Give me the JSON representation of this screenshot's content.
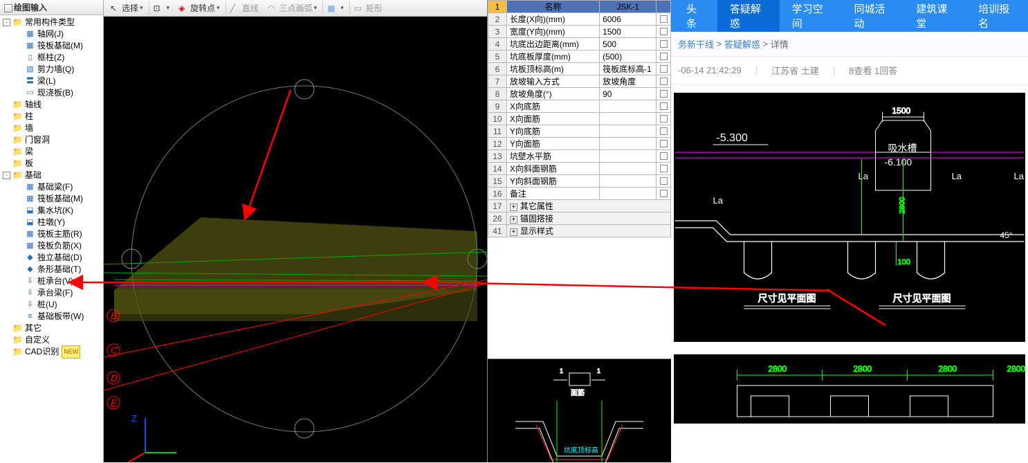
{
  "tree": {
    "title": "绘图输入",
    "nodes": [
      {
        "indent": 0,
        "toggle": "-",
        "icon": "fold",
        "label": "常用构件类型"
      },
      {
        "indent": 1,
        "icon": "blue",
        "glyph": "▦",
        "label": "轴网(J)"
      },
      {
        "indent": 1,
        "icon": "blue",
        "glyph": "▦",
        "label": "筏板基础(M)"
      },
      {
        "indent": 1,
        "icon": "blue",
        "glyph": "▯",
        "label": "框柱(Z)"
      },
      {
        "indent": 1,
        "icon": "blue",
        "glyph": "▧",
        "label": "剪力墙(Q)"
      },
      {
        "indent": 1,
        "icon": "blue",
        "glyph": "〓",
        "label": "梁(L)"
      },
      {
        "indent": 1,
        "icon": "blue",
        "glyph": "▭",
        "label": "现浇板(B)"
      },
      {
        "indent": 0,
        "icon": "fold",
        "label": "轴线"
      },
      {
        "indent": 0,
        "icon": "fold",
        "label": "柱"
      },
      {
        "indent": 0,
        "icon": "fold",
        "label": "墙"
      },
      {
        "indent": 0,
        "icon": "fold",
        "label": "门窗洞"
      },
      {
        "indent": 0,
        "icon": "fold",
        "label": "梁"
      },
      {
        "indent": 0,
        "icon": "fold",
        "label": "板"
      },
      {
        "indent": 0,
        "toggle": "-",
        "icon": "fold",
        "label": "基础"
      },
      {
        "indent": 1,
        "icon": "blue",
        "glyph": "▦",
        "label": "基础梁(F)"
      },
      {
        "indent": 1,
        "icon": "blue",
        "glyph": "▦",
        "label": "筏板基础(M)"
      },
      {
        "indent": 1,
        "icon": "blue",
        "glyph": "⬓",
        "label": "集水坑(K)"
      },
      {
        "indent": 1,
        "icon": "blue",
        "glyph": "⬓",
        "label": "柱墩(Y)"
      },
      {
        "indent": 1,
        "icon": "blue",
        "glyph": "▦",
        "label": "筏板主筋(R)"
      },
      {
        "indent": 1,
        "icon": "blue",
        "glyph": "▦",
        "label": "筏板负筋(X)"
      },
      {
        "indent": 1,
        "icon": "blue",
        "glyph": "◆",
        "label": "独立基础(D)"
      },
      {
        "indent": 1,
        "icon": "blue",
        "glyph": "◆",
        "label": "条形基础(T)"
      },
      {
        "indent": 1,
        "icon": "blue",
        "glyph": "⇩",
        "label": "桩承台(V)"
      },
      {
        "indent": 1,
        "icon": "blue",
        "glyph": "⇩",
        "label": "承台梁(F)"
      },
      {
        "indent": 1,
        "icon": "blue",
        "glyph": "⇩",
        "label": "桩(U)"
      },
      {
        "indent": 1,
        "icon": "blue",
        "glyph": "≡",
        "label": "基础板带(W)"
      },
      {
        "indent": 0,
        "icon": "fold",
        "label": "其它"
      },
      {
        "indent": 0,
        "icon": "fold",
        "label": "自定义"
      },
      {
        "indent": 0,
        "icon": "fold",
        "label": "CAD识别",
        "new": true
      }
    ]
  },
  "toolbar": {
    "select": "选择",
    "pick": "",
    "rotate": "旋转点",
    "line": "直线",
    "arc": "三点画弧",
    "rect": "矩形"
  },
  "viewport": {
    "axis_labels": [
      "B",
      "C",
      "D",
      "E"
    ],
    "zlabel": "Z"
  },
  "props": {
    "header_name": "名称",
    "header_value": "JSK-1",
    "rows": [
      {
        "n": 2,
        "name": "长度(X向)(mm)",
        "val": "6006"
      },
      {
        "n": 3,
        "name": "宽度(Y向)(mm)",
        "val": "1500"
      },
      {
        "n": 4,
        "name": "坑底出边距离(mm)",
        "val": "500"
      },
      {
        "n": 5,
        "name": "坑底板厚度(mm)",
        "val": "(500)"
      },
      {
        "n": 6,
        "name": "坑板顶标高(m)",
        "val": "筏板底标高-1"
      },
      {
        "n": 7,
        "name": "放坡输入方式",
        "val": "放坡角度"
      },
      {
        "n": 8,
        "name": "放坡角度(°)",
        "val": "90"
      },
      {
        "n": 9,
        "name": "X向底筋",
        "val": "",
        "link": true
      },
      {
        "n": 10,
        "name": "X向面筋",
        "val": "",
        "link": true
      },
      {
        "n": 11,
        "name": "Y向底筋",
        "val": "",
        "link": true
      },
      {
        "n": 12,
        "name": "Y向面筋",
        "val": "",
        "link": true
      },
      {
        "n": 13,
        "name": "坑壁水平筋",
        "val": "",
        "link": true
      },
      {
        "n": 14,
        "name": "X向斜面钢筋",
        "val": "",
        "link": true
      },
      {
        "n": 15,
        "name": "Y向斜面钢筋",
        "val": "",
        "link": true
      },
      {
        "n": 16,
        "name": "备注",
        "val": ""
      }
    ],
    "groups": [
      {
        "n": 17,
        "label": "其它属性"
      },
      {
        "n": 26,
        "label": "锚固搭接"
      },
      {
        "n": 41,
        "label": "显示样式"
      }
    ]
  },
  "web": {
    "nav": [
      {
        "label": "头条"
      },
      {
        "label": "答疑解惑",
        "active": true
      },
      {
        "label": "学习空间"
      },
      {
        "label": "同城活动"
      },
      {
        "label": "建筑课堂"
      },
      {
        "label": "培训报名"
      }
    ],
    "crumb_a": "务新干线",
    "crumb_b": "答疑解惑",
    "crumb_c": "详情",
    "meta_time": "-06-14 21:42:29",
    "meta_loc": "江苏省  土建",
    "meta_stat": "8查看  1回答",
    "dwg": {
      "elev1": "-5.300",
      "title": "吸水槽",
      "elev2": "-6.100",
      "dim_top": "1500",
      "la": "La",
      "dim_v": "2800",
      "dim_100": "100",
      "angle": "45°",
      "cap1": "尺寸见平面图",
      "cap2": "尺寸见平面图",
      "bot_a": "2800",
      "bot_b": "2800",
      "bot_c": "2800"
    }
  }
}
